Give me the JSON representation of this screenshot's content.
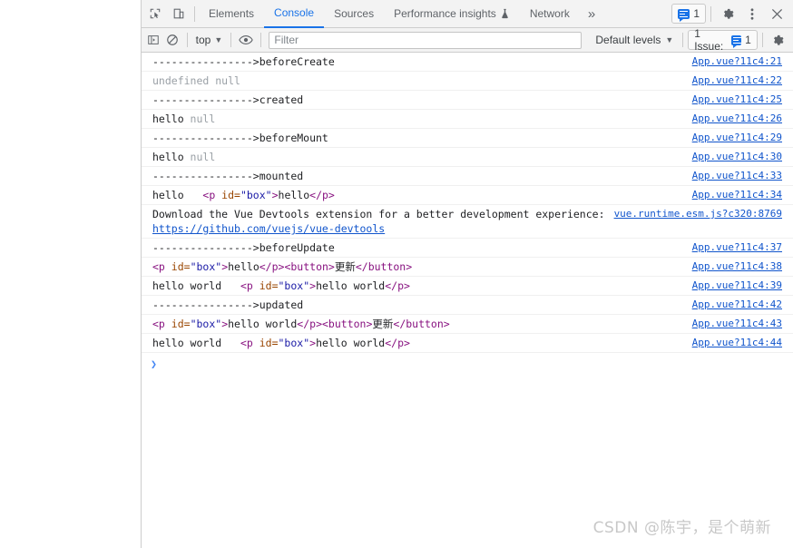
{
  "tabbar": {
    "inspect_icon": "inspect-cursor-icon",
    "device_icon": "device-toolbar-icon",
    "tabs": [
      {
        "label": "Elements",
        "active": false
      },
      {
        "label": "Console",
        "active": true
      },
      {
        "label": "Sources",
        "active": false
      },
      {
        "label": "Performance insights",
        "active": false,
        "icon": "beaker-icon"
      },
      {
        "label": "Network",
        "active": false
      }
    ],
    "more_tabs": "»",
    "issues_count": "1",
    "settings_icon": "gear-icon",
    "more_options_icon": "kebab-menu-icon",
    "close_icon": "close-icon"
  },
  "console_toolbar": {
    "sidebar_toggle_icon": "console-sidebar-icon",
    "clear_icon": "clear-console-icon",
    "context": "top",
    "eye_icon": "live-expression-eye-icon",
    "filter_placeholder": "Filter",
    "filter_value": "",
    "levels": "Default levels",
    "issue_chip_label": "1 Issue:",
    "issue_chip_count": "1",
    "settings_icon": "console-settings-gear-icon"
  },
  "console": {
    "rows": [
      {
        "parts": [
          {
            "t": "---------------->beforeCreate",
            "c": "txt"
          }
        ],
        "source": "App.vue?11c4:21"
      },
      {
        "parts": [
          {
            "t": "undefined null",
            "c": "dim"
          }
        ],
        "source": "App.vue?11c4:22"
      },
      {
        "parts": [
          {
            "t": "---------------->created",
            "c": "txt"
          }
        ],
        "source": "App.vue?11c4:25"
      },
      {
        "parts": [
          {
            "t": "hello ",
            "c": "txt"
          },
          {
            "t": "null",
            "c": "dim"
          }
        ],
        "source": "App.vue?11c4:26"
      },
      {
        "parts": [
          {
            "t": "---------------->beforeMount",
            "c": "txt"
          }
        ],
        "source": "App.vue?11c4:29"
      },
      {
        "parts": [
          {
            "t": "hello ",
            "c": "txt"
          },
          {
            "t": "null",
            "c": "dim"
          }
        ],
        "source": "App.vue?11c4:30"
      },
      {
        "parts": [
          {
            "t": "---------------->mounted",
            "c": "txt"
          }
        ],
        "source": "App.vue?11c4:33"
      },
      {
        "parts": [
          {
            "t": "hello   ",
            "c": "txt"
          },
          {
            "t": "<p ",
            "c": "tag"
          },
          {
            "t": "id=",
            "c": "attr"
          },
          {
            "t": "\"box\"",
            "c": "val"
          },
          {
            "t": ">",
            "c": "tag"
          },
          {
            "t": "hello",
            "c": "txt"
          },
          {
            "t": "</p>",
            "c": "tag"
          }
        ],
        "source": "App.vue?11c4:34"
      },
      {
        "parts": [
          {
            "t": "Download the Vue Devtools extension for a better development experience: ",
            "c": "txt"
          }
        ],
        "link": "https://github.com/vuejs/vue-devtools",
        "source": "vue.runtime.esm.js?c320:8769"
      },
      {
        "parts": [
          {
            "t": "---------------->beforeUpdate",
            "c": "txt"
          }
        ],
        "source": "App.vue?11c4:37"
      },
      {
        "parts": [
          {
            "t": "<p ",
            "c": "tag"
          },
          {
            "t": "id=",
            "c": "attr"
          },
          {
            "t": "\"box\"",
            "c": "val"
          },
          {
            "t": ">",
            "c": "tag"
          },
          {
            "t": "hello",
            "c": "txt"
          },
          {
            "t": "</p>",
            "c": "tag"
          },
          {
            "t": "<button>",
            "c": "tag"
          },
          {
            "t": "更新",
            "c": "txt"
          },
          {
            "t": "</button>",
            "c": "tag"
          }
        ],
        "source": "App.vue?11c4:38"
      },
      {
        "parts": [
          {
            "t": "hello world   ",
            "c": "txt"
          },
          {
            "t": "<p ",
            "c": "tag"
          },
          {
            "t": "id=",
            "c": "attr"
          },
          {
            "t": "\"box\"",
            "c": "val"
          },
          {
            "t": ">",
            "c": "tag"
          },
          {
            "t": "hello world",
            "c": "txt"
          },
          {
            "t": "</p>",
            "c": "tag"
          }
        ],
        "source": "App.vue?11c4:39"
      },
      {
        "parts": [
          {
            "t": "---------------->updated",
            "c": "txt"
          }
        ],
        "source": "App.vue?11c4:42"
      },
      {
        "parts": [
          {
            "t": "<p ",
            "c": "tag"
          },
          {
            "t": "id=",
            "c": "attr"
          },
          {
            "t": "\"box\"",
            "c": "val"
          },
          {
            "t": ">",
            "c": "tag"
          },
          {
            "t": "hello world",
            "c": "txt"
          },
          {
            "t": "</p>",
            "c": "tag"
          },
          {
            "t": "<button>",
            "c": "tag"
          },
          {
            "t": "更新",
            "c": "txt"
          },
          {
            "t": "</button>",
            "c": "tag"
          }
        ],
        "source": "App.vue?11c4:43"
      },
      {
        "parts": [
          {
            "t": "hello world   ",
            "c": "txt"
          },
          {
            "t": "<p ",
            "c": "tag"
          },
          {
            "t": "id=",
            "c": "attr"
          },
          {
            "t": "\"box\"",
            "c": "val"
          },
          {
            "t": ">",
            "c": "tag"
          },
          {
            "t": "hello world",
            "c": "txt"
          },
          {
            "t": "</p>",
            "c": "tag"
          }
        ],
        "source": "App.vue?11c4:44"
      }
    ],
    "prompt_caret": "❯",
    "prompt_value": ""
  },
  "watermark": "CSDN @陈宇，是个萌新",
  "colors": {
    "accent": "#1a73e8",
    "link": "#1155cc",
    "toolbar_bg": "#f3f3f3",
    "border": "#cdcdcd",
    "tag": "#881280",
    "attr": "#994500",
    "value": "#1a1aa6",
    "dim": "#9aa0a6"
  }
}
